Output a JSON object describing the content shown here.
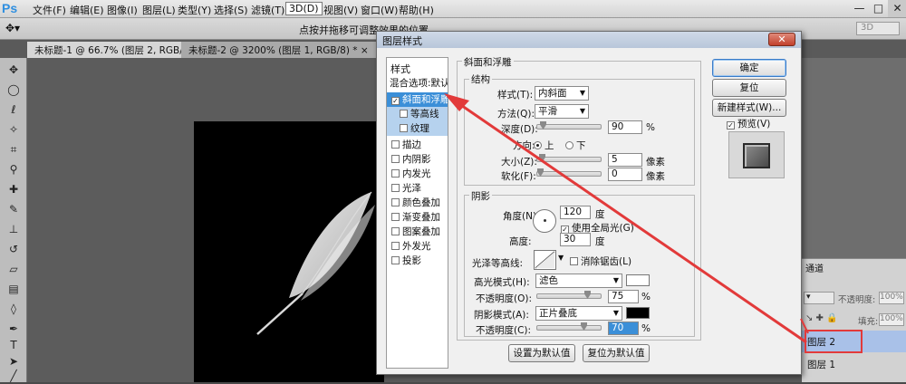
{
  "app": {
    "logo": "Ps"
  },
  "menubar": {
    "items": [
      "文件(F)",
      "编辑(E)",
      "图像(I)",
      "图层(L)",
      "类型(Y)",
      "选择(S)",
      "滤镜(T)",
      "3D(D)",
      "视图(V)",
      "窗口(W)",
      "帮助(H)"
    ],
    "active_index": 7,
    "minimize": "—",
    "restore": "□",
    "close": "✕"
  },
  "options_bar": {
    "tool_icon": "move-icon",
    "hint": "点按并拖移可调整效果的位置。",
    "mode_3d": "3D"
  },
  "doc_tabs": [
    "未标题-1 @ 66.7% (图层 2, RGB/8) *  ×",
    "未标题-2 @ 3200% (图层 1, RGB/8) *  ×"
  ],
  "dialog": {
    "title": "图层样式",
    "close": "✕",
    "styles_header": "样式",
    "blend_options": "混合选项:默认",
    "styles": [
      {
        "label": "斜面和浮雕",
        "checked": true,
        "selected": true
      },
      {
        "label": "等高线",
        "checked": false,
        "sub": true
      },
      {
        "label": "纹理",
        "checked": false,
        "sub": true
      },
      {
        "label": "描边",
        "checked": false
      },
      {
        "label": "内阴影",
        "checked": false
      },
      {
        "label": "内发光",
        "checked": false
      },
      {
        "label": "光泽",
        "checked": false
      },
      {
        "label": "颜色叠加",
        "checked": false
      },
      {
        "label": "渐变叠加",
        "checked": false
      },
      {
        "label": "图案叠加",
        "checked": false
      },
      {
        "label": "外发光",
        "checked": false
      },
      {
        "label": "投影",
        "checked": false
      }
    ],
    "bevel": {
      "group_title": "斜面和浮雕",
      "structure_title": "结构",
      "style_label": "样式(T):",
      "style_value": "内斜面",
      "technique_label": "方法(Q):",
      "technique_value": "平滑",
      "depth_label": "深度(D):",
      "depth_value": "90",
      "depth_unit": "%",
      "direction_label": "方向:",
      "dir_up": "上",
      "dir_down": "下",
      "size_label": "大小(Z):",
      "size_value": "5",
      "size_unit": "像素",
      "soften_label": "软化(F):",
      "soften_value": "0",
      "soften_unit": "像素"
    },
    "shading": {
      "title": "阴影",
      "angle_label": "角度(N):",
      "angle_value": "120",
      "angle_unit": "度",
      "global_light": "使用全局光(G)",
      "altitude_label": "高度:",
      "altitude_value": "30",
      "altitude_unit": "度",
      "gloss_label": "光泽等高线:",
      "antialias": "消除锯齿(L)",
      "highlight_label": "高光模式(H):",
      "highlight_value": "滤色",
      "highlight_color": "#ffffff",
      "hl_opacity_label": "不透明度(O):",
      "hl_opacity_value": "75",
      "hl_opacity_unit": "%",
      "shadow_label": "阴影模式(A):",
      "shadow_value": "正片叠底",
      "shadow_color": "#000000",
      "sh_opacity_label": "不透明度(C):",
      "sh_opacity_value": "70",
      "sh_opacity_unit": "%"
    },
    "make_default": "设置为默认值",
    "reset_default": "复位为默认值",
    "ok": "确定",
    "reset": "复位",
    "new_style": "新建样式(W)...",
    "preview": "预览(V)"
  },
  "layers_panel": {
    "tab": "通道",
    "opacity_label": "不透明度:",
    "opacity_value": "100%",
    "fill_label": "填充:",
    "fill_value": "100%",
    "layers": [
      "图层 2",
      "图层 1"
    ]
  },
  "colors": {
    "highlight_box": "#e23a3a",
    "arrow": "#e23a3a",
    "selection": "#3b8fd8"
  }
}
